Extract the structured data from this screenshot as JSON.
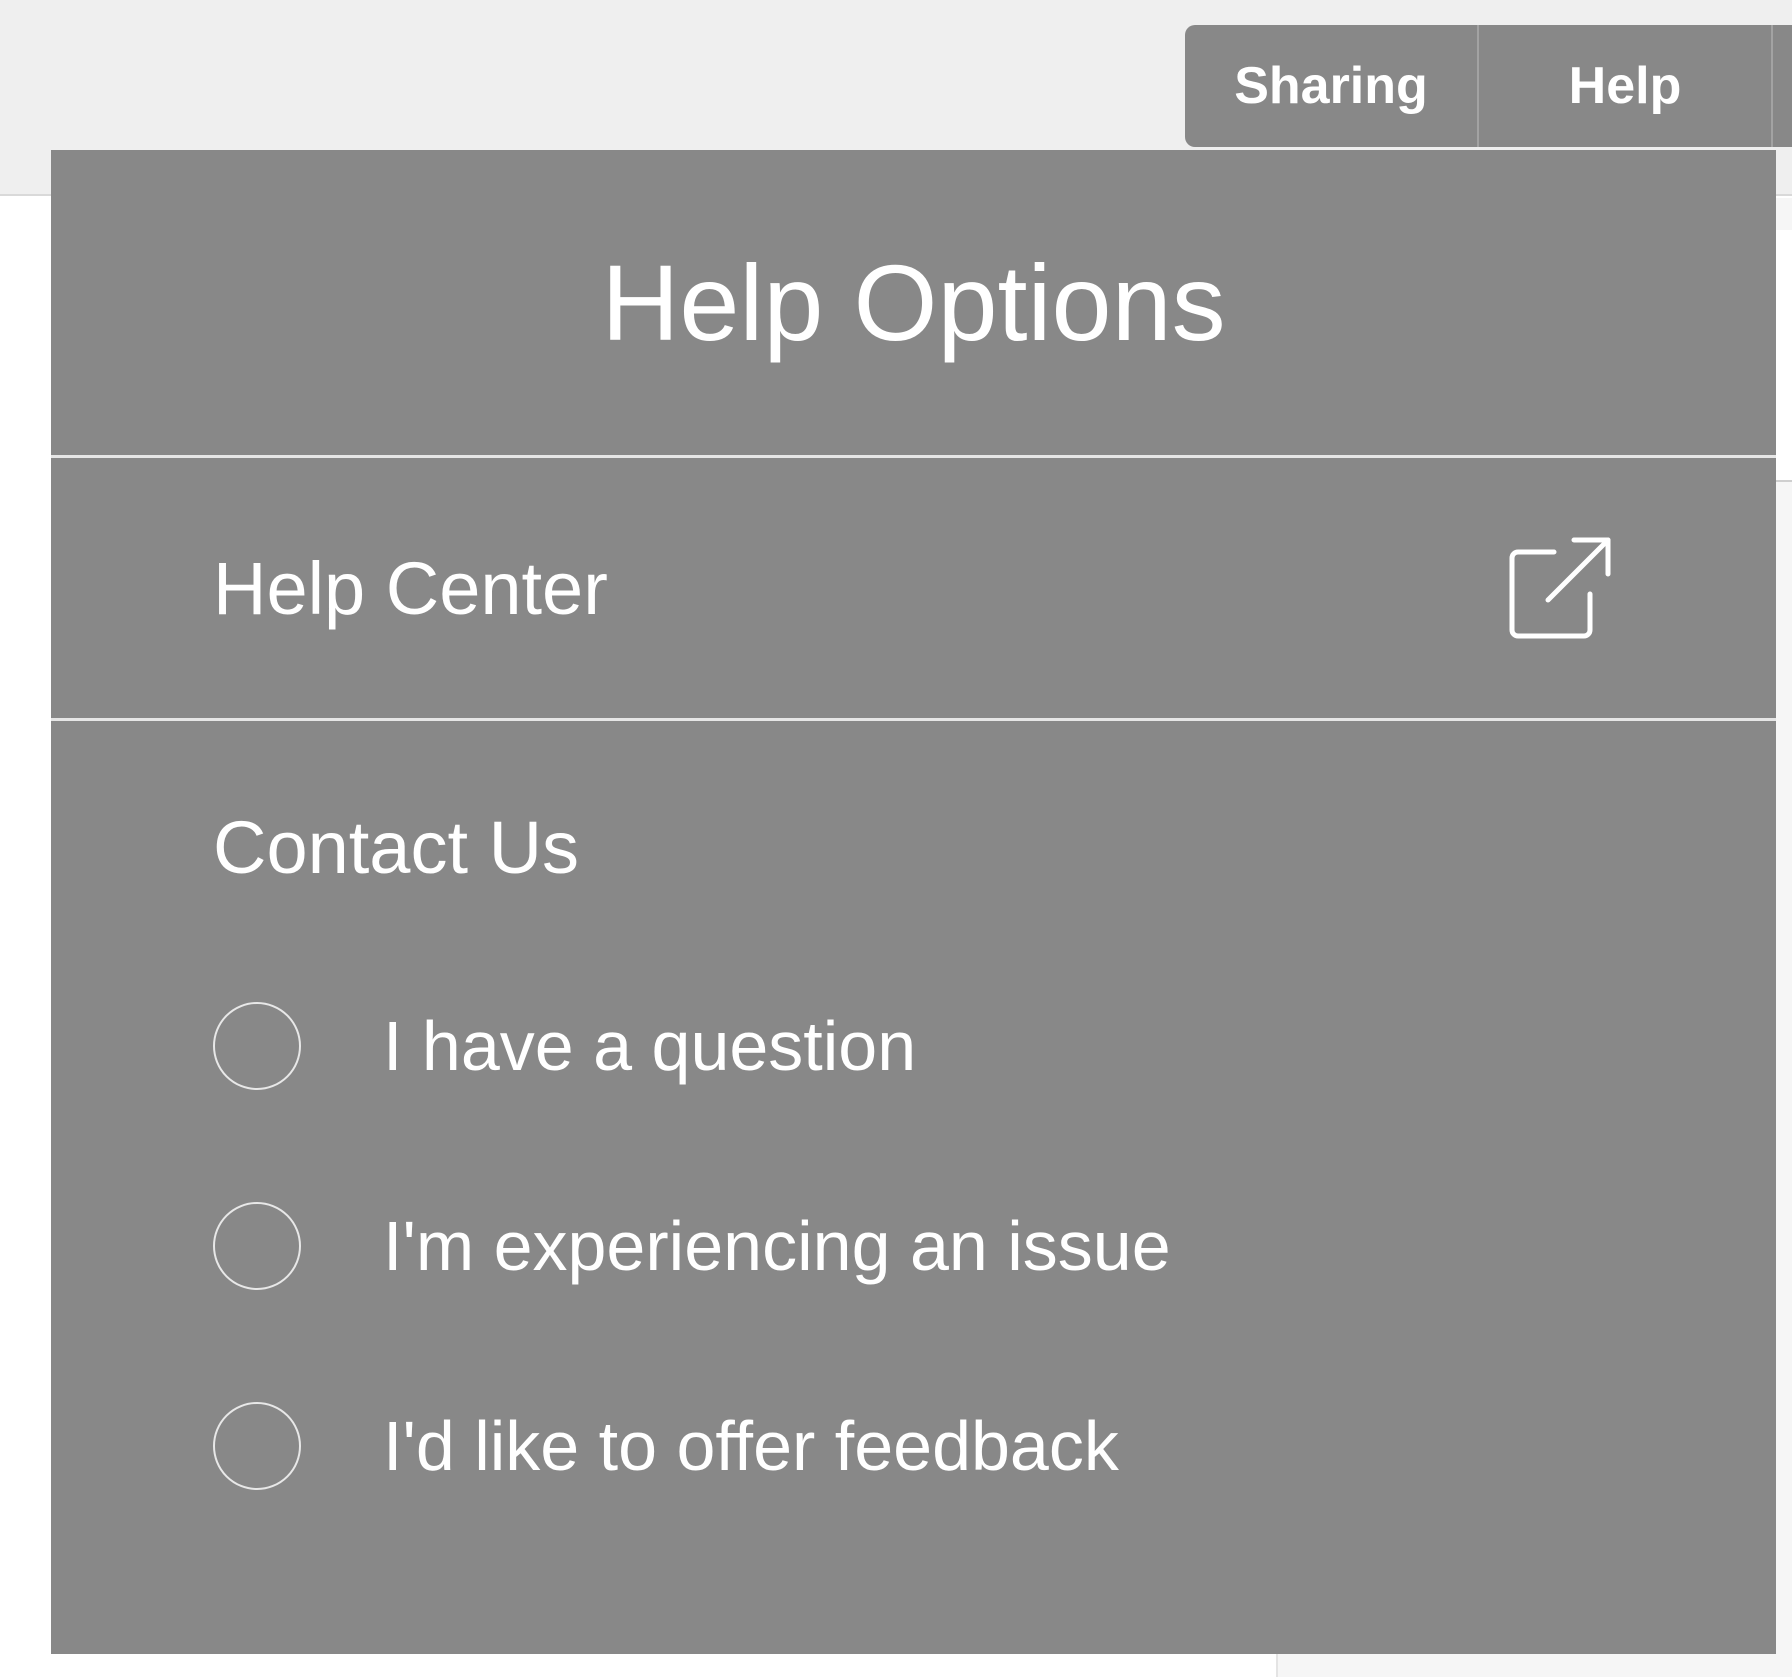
{
  "nav": {
    "sharing_label": "Sharing",
    "help_label": "Help"
  },
  "help_panel": {
    "title": "Help Options",
    "help_center_label": "Help Center",
    "help_center_icon": "external-link-icon",
    "contact_heading": "Contact Us",
    "options": [
      {
        "label": "I have a question",
        "selected": false
      },
      {
        "label": "I'm experiencing an issue",
        "selected": false
      },
      {
        "label": "I'd like to offer feedback",
        "selected": false
      }
    ]
  },
  "colors": {
    "panel_bg": "#888888",
    "panel_text": "#ffffff",
    "topbar_bg": "#efefef"
  }
}
